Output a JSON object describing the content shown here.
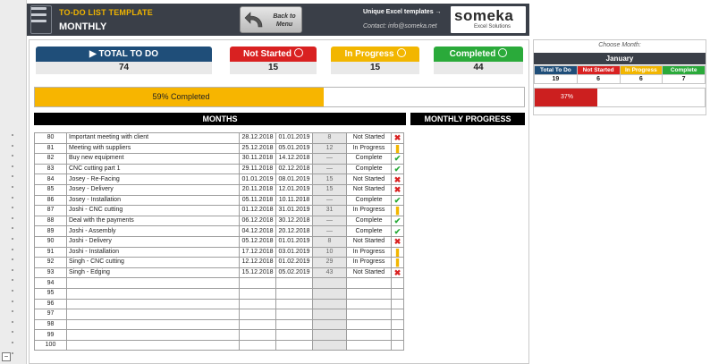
{
  "header": {
    "title": "TO-DO LIST TEMPLATE",
    "subtitle": "MONTHLY",
    "back_label_1": "Back to",
    "back_label_2": "Menu",
    "unique": "Unique Excel templates →",
    "contact": "Contact: info@someka.net",
    "logo_name": "someka",
    "logo_tag": "Excel Solutions"
  },
  "summary": {
    "total_label": "▶ TOTAL TO DO",
    "total_value": "74",
    "not_started_label": "Not Started",
    "not_started_value": "15",
    "in_progress_label": "In Progress",
    "in_progress_value": "15",
    "completed_label": "Completed",
    "completed_value": "44"
  },
  "progress": {
    "label": "59% Completed",
    "percent": 59
  },
  "sections": {
    "months": "MONTHS",
    "monthly_progress": "MONTHLY PROGRESS"
  },
  "tasks": [
    {
      "num": "80",
      "task": "Important meeting with client",
      "start": "28.12.2018",
      "end": "01.01.2019",
      "days": "8",
      "status": "Not Started",
      "icon": "x"
    },
    {
      "num": "81",
      "task": "Meeting with suppliers",
      "start": "25.12.2018",
      "end": "05.01.2019",
      "days": "12",
      "status": "In Progress",
      "icon": "p"
    },
    {
      "num": "82",
      "task": "Buy new equipment",
      "start": "30.11.2018",
      "end": "14.12.2018",
      "days": "—",
      "status": "Complete",
      "icon": "ok"
    },
    {
      "num": "83",
      "task": "CNC cutting part 1",
      "start": "29.11.2018",
      "end": "02.12.2018",
      "days": "—",
      "status": "Complete",
      "icon": "ok"
    },
    {
      "num": "84",
      "task": "Josey - Re-Facing",
      "start": "01.01.2019",
      "end": "08.01.2019",
      "days": "15",
      "status": "Not Started",
      "icon": "x"
    },
    {
      "num": "85",
      "task": "Josey - Delivery",
      "start": "20.11.2018",
      "end": "12.01.2019",
      "days": "15",
      "status": "Not Started",
      "icon": "x"
    },
    {
      "num": "86",
      "task": "Josey - Installation",
      "start": "05.11.2018",
      "end": "10.11.2018",
      "days": "—",
      "status": "Complete",
      "icon": "ok"
    },
    {
      "num": "87",
      "task": "Joshi - CNC cutting",
      "start": "01.12.2018",
      "end": "31.01.2019",
      "days": "31",
      "status": "In Progress",
      "icon": "p"
    },
    {
      "num": "88",
      "task": "Deal with the payments",
      "start": "06.12.2018",
      "end": "30.12.2018",
      "days": "—",
      "status": "Complete",
      "icon": "ok"
    },
    {
      "num": "89",
      "task": "Joshi - Assembly",
      "start": "04.12.2018",
      "end": "20.12.2018",
      "days": "—",
      "status": "Complete",
      "icon": "ok"
    },
    {
      "num": "90",
      "task": "Joshi - Delivery",
      "start": "05.12.2018",
      "end": "01.01.2019",
      "days": "8",
      "status": "Not Started",
      "icon": "x"
    },
    {
      "num": "91",
      "task": "Joshi - Installation",
      "start": "17.12.2018",
      "end": "03.01.2019",
      "days": "10",
      "status": "In Progress",
      "icon": "p"
    },
    {
      "num": "92",
      "task": "Singh - CNC cutting",
      "start": "12.12.2018",
      "end": "01.02.2019",
      "days": "29",
      "status": "In Progress",
      "icon": "p"
    },
    {
      "num": "93",
      "task": "Singh - Edging",
      "start": "15.12.2018",
      "end": "05.02.2019",
      "days": "43",
      "status": "Not Started",
      "icon": "x"
    },
    {
      "num": "94",
      "task": "",
      "start": "",
      "end": "",
      "days": "",
      "status": "",
      "icon": ""
    },
    {
      "num": "95",
      "task": "",
      "start": "",
      "end": "",
      "days": "",
      "status": "",
      "icon": ""
    },
    {
      "num": "96",
      "task": "",
      "start": "",
      "end": "",
      "days": "",
      "status": "",
      "icon": ""
    },
    {
      "num": "97",
      "task": "",
      "start": "",
      "end": "",
      "days": "",
      "status": "",
      "icon": ""
    },
    {
      "num": "98",
      "task": "",
      "start": "",
      "end": "",
      "days": "",
      "status": "",
      "icon": ""
    },
    {
      "num": "99",
      "task": "",
      "start": "",
      "end": "",
      "days": "",
      "status": "",
      "icon": ""
    },
    {
      "num": "100",
      "task": "",
      "start": "",
      "end": "",
      "days": "",
      "status": "",
      "icon": ""
    }
  ],
  "right": {
    "choose_label": "Choose Month:",
    "month": "January",
    "cols": [
      "Total To Do",
      "Not Started",
      "In Progress",
      "Complete"
    ],
    "col_colors": [
      "#1f4e79",
      "#d92121",
      "#f2b600",
      "#2aaa3a"
    ],
    "values": [
      "19",
      "6",
      "6",
      "7"
    ],
    "progress_label": "37%",
    "progress_percent": 37
  }
}
